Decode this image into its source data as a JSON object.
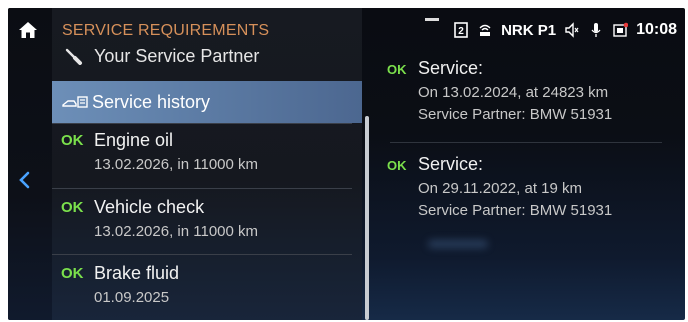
{
  "header": {
    "title": "SERVICE REQUIREMENTS"
  },
  "nav": {
    "partner_label": "Your Service Partner",
    "history_label": "Service history"
  },
  "items": [
    {
      "status": "OK",
      "name": "Engine oil",
      "detail": "13.02.2026, in 11000 km"
    },
    {
      "status": "OK",
      "name": "Vehicle check",
      "detail": "13.02.2026, in 11000 km"
    },
    {
      "status": "OK",
      "name": "Brake fluid",
      "detail": "01.09.2025"
    }
  ],
  "status_bar": {
    "station": "NRK P1",
    "time": "10:08",
    "icons": [
      "sim-icon",
      "car-wifi-icon",
      "speaker-icon",
      "microphone-icon",
      "message-icon"
    ]
  },
  "history": [
    {
      "status": "OK",
      "title": "Service:",
      "line1": "On 13.02.2024, at 24823 km",
      "line2": "Service Partner: BMW 51931"
    },
    {
      "status": "OK",
      "title": "Service:",
      "line1": "On 29.11.2022, at 19 km",
      "line2": "Service Partner: BMW 51931"
    }
  ],
  "colors": {
    "accent": "#d6905a",
    "ok": "#7be04c",
    "highlight": "#6d8fb8"
  }
}
